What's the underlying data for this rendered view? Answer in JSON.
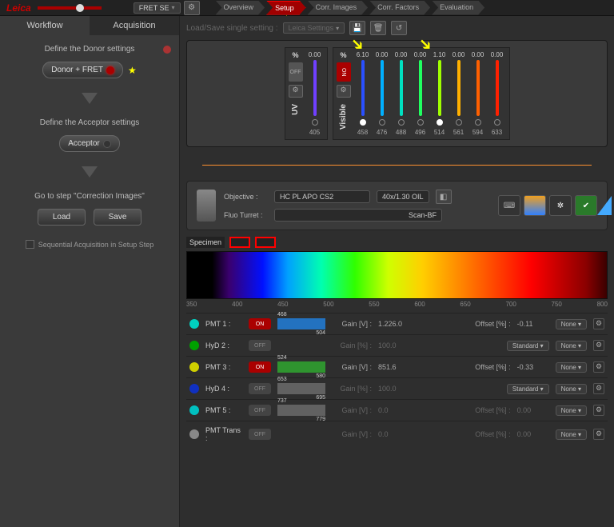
{
  "topbar": {
    "mode": "FRET SE",
    "tabs": [
      "Overview",
      "Setup",
      "Corr. Images",
      "Corr. Factors",
      "Evaluation"
    ],
    "active_tab": "Setup"
  },
  "sidebar": {
    "tabs": [
      "Workflow",
      "Acquisition"
    ],
    "active": "Workflow",
    "donor": {
      "title": "Define the Donor settings",
      "button": "Donor + FRET"
    },
    "acceptor": {
      "title": "Define the Acceptor settings",
      "button": "Acceptor"
    },
    "step3": "Go to step \"Correction Images\"",
    "load": "Load",
    "save": "Save",
    "seq": "Sequential Acquisition in Setup Step"
  },
  "subtoolbar": {
    "label": "Load/Save single setting :",
    "menu": "Leica Settings"
  },
  "lasers": {
    "uv": {
      "label": "UV",
      "pct": "%",
      "value": "0.00",
      "nm": "405"
    },
    "visible": {
      "label": "Visible",
      "pct": "%",
      "lines": [
        {
          "val": "6.10",
          "nm": "458",
          "color": "#2a50ff",
          "on": true
        },
        {
          "val": "0.00",
          "nm": "476",
          "color": "#00b0ff",
          "on": false
        },
        {
          "val": "0.00",
          "nm": "488",
          "color": "#00e0c0",
          "on": false
        },
        {
          "val": "0.00",
          "nm": "496",
          "color": "#20ff60",
          "on": false
        },
        {
          "val": "1.10",
          "nm": "514",
          "color": "#a0ff00",
          "on": true
        },
        {
          "val": "0.00",
          "nm": "561",
          "color": "#ffb000",
          "on": false
        },
        {
          "val": "0.00",
          "nm": "594",
          "color": "#ff6000",
          "on": false
        },
        {
          "val": "0.00",
          "nm": "633",
          "color": "#ff2000",
          "on": false
        }
      ]
    }
  },
  "objective": {
    "obj_label": "Objective :",
    "obj_name": "HC PL APO CS2",
    "obj_mag": "40x/1.30 OIL",
    "fluo_label": "Fluo Turret :",
    "fluo_val": "Scan-BF"
  },
  "specimen": "Specimen",
  "scale": [
    "350",
    "400",
    "450",
    "500",
    "550",
    "600",
    "650",
    "700",
    "750",
    "800"
  ],
  "detectors": [
    {
      "name": "PMT 1 :",
      "color": "#00d0c0",
      "on": true,
      "on_txt": "ON",
      "gain_lbl": "Gain [V] :",
      "gain": "1.226.0",
      "off_lbl": "Offset [%] :",
      "off": "-0.11",
      "std": null,
      "none": "None",
      "active": true,
      "band": {
        "lo": "468",
        "hi": "504",
        "color": "#2090ff"
      }
    },
    {
      "name": "HyD 2 :",
      "color": "#00a000",
      "on": false,
      "on_txt": "OFF",
      "gain_lbl": "Gain [%] :",
      "gain": "100.0",
      "off_lbl": null,
      "off": null,
      "std": "Standard",
      "none": "None",
      "active": false,
      "band": null
    },
    {
      "name": "PMT 3 :",
      "color": "#d0d000",
      "on": true,
      "on_txt": "ON",
      "gain_lbl": "Gain [V] :",
      "gain": "851.6",
      "off_lbl": "Offset [%] :",
      "off": "-0.33",
      "std": null,
      "none": "None",
      "active": true,
      "band": {
        "lo": "524",
        "hi": "580",
        "color": "#30c030"
      }
    },
    {
      "name": "HyD 4 :",
      "color": "#1030c0",
      "on": false,
      "on_txt": "OFF",
      "gain_lbl": "Gain [%] :",
      "gain": "100.0",
      "off_lbl": null,
      "off": null,
      "std": "Standard",
      "none": "None",
      "active": false,
      "band": {
        "lo": "653",
        "hi": "695",
        "color": "#777"
      }
    },
    {
      "name": "PMT 5 :",
      "color": "#00c0c0",
      "on": false,
      "on_txt": "OFF",
      "gain_lbl": "Gain [V] :",
      "gain": "0.0",
      "off_lbl": "Offset [%] :",
      "off": "0.00",
      "std": null,
      "none": "None",
      "active": false,
      "band": {
        "lo": "737",
        "hi": "779",
        "color": "#777"
      }
    },
    {
      "name": "PMT Trans :",
      "color": "#888",
      "on": false,
      "on_txt": "OFF",
      "gain_lbl": "Gain [V] :",
      "gain": "0.0",
      "off_lbl": "Offset [%] :",
      "off": "0.00",
      "std": null,
      "none": "None",
      "active": false,
      "band": null
    }
  ]
}
